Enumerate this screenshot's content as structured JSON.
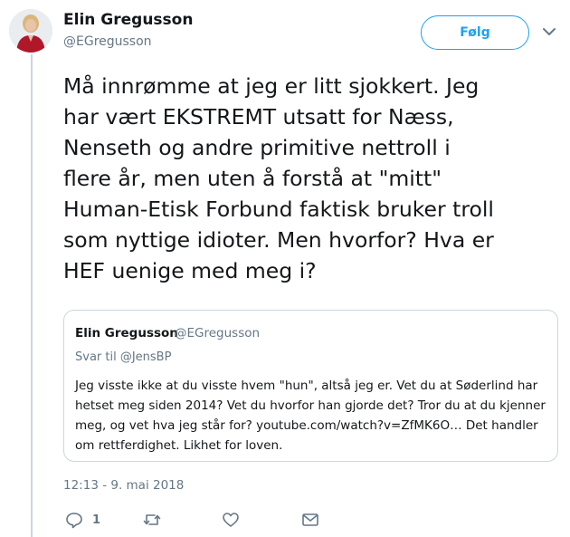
{
  "author": {
    "name": "Elin Gregusson",
    "handle": "@EGregusson",
    "avatar_icon": "profile-photo"
  },
  "header": {
    "follow_label": "Følg",
    "menu_icon": "chevron-down-icon"
  },
  "tweet": {
    "text": "Må innrømme at jeg er litt sjokkert. Jeg\nhar vært EKSTREMT utsatt for Næss,\nNenseth og andre primitive nettroll i\nflere år, men uten å forstå at \"mitt\"\nHuman-Etisk Forbund faktisk bruker troll\nsom nyttige idioter. Men hvorfor? Hva er\nHEF uenige med meg i?",
    "timestamp": "12:13 - 9. mai 2018"
  },
  "quoted_tweet": {
    "name": "Elin Gregusson",
    "handle": "@EGregusson",
    "reply_to": "Svar til @JensBP",
    "text": "Jeg visste ikke at du visste hvem \"hun\", altså jeg er. Vet du at Søderlind har\nhetset meg siden 2014? Vet du hvorfor han gjorde det? Tror du at du kjenner\nmeg, og vet hva jeg står for? youtube.com/watch?v=ZfMK6O… Det handler\nom rettferdighet. Likhet for loven."
  },
  "actions": {
    "reply_count": "1",
    "reply_icon": "reply-icon",
    "retweet_icon": "retweet-icon",
    "like_icon": "heart-icon",
    "dm_icon": "envelope-icon"
  },
  "colors": {
    "accent": "#1da1f2",
    "muted": "#657786",
    "border": "#ccd6dd"
  }
}
